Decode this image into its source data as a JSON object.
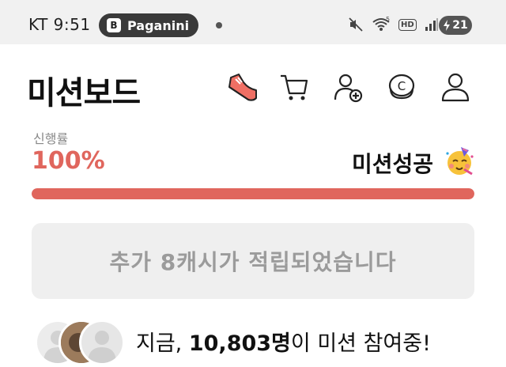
{
  "status_bar": {
    "carrier": "KT",
    "time": "9:51",
    "notification_app": "Paganini",
    "notification_icon_letter": "B",
    "network": "5",
    "hd_label": "HD",
    "battery_level": "21"
  },
  "header": {
    "title": "미션보드",
    "icons": [
      "sneaker-icon",
      "cart-icon",
      "add-friend-icon",
      "cash-icon",
      "profile-icon"
    ],
    "cash_icon_glyph": "C"
  },
  "progress": {
    "label": "신행률",
    "value_text": "100%",
    "fraction": 1.0,
    "status": "미션성공",
    "accent_color": "#e0665d"
  },
  "cash_notice": {
    "text": "추가 8캐시가 적립되었습니다"
  },
  "participants": {
    "prefix": "지금, ",
    "count": "10,803명",
    "suffix": "이 미션 참여중!"
  }
}
